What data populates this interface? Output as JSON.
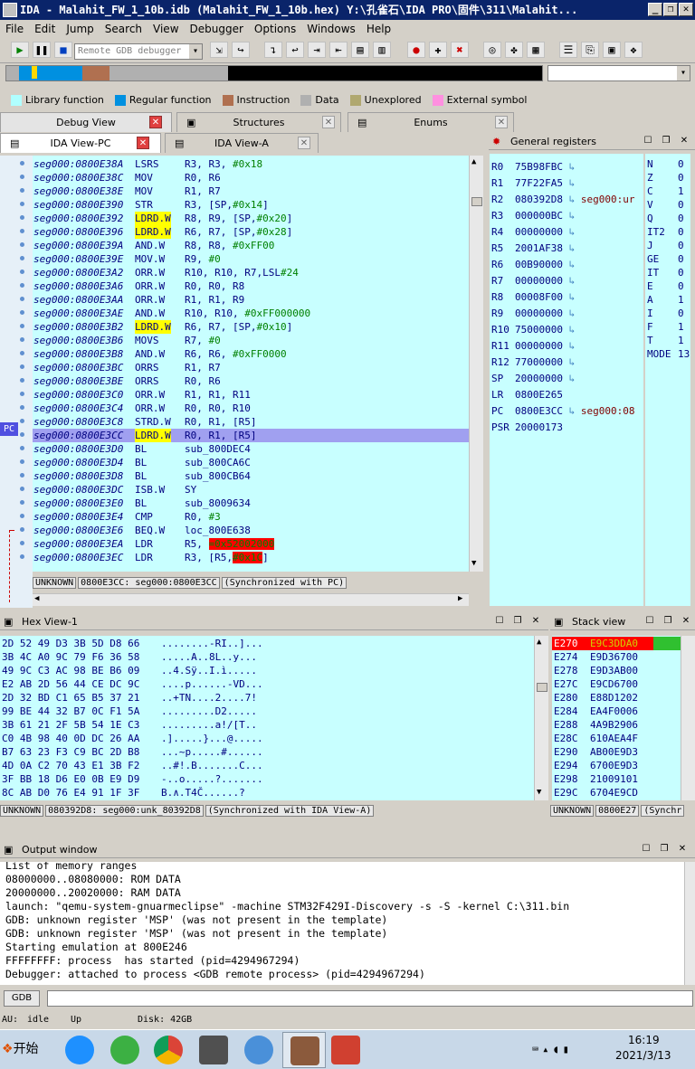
{
  "window": {
    "title": "IDA - Malahit_FW_1_10b.idb (Malahit_FW_1_10b.hex) Y:\\孔雀石\\IDA PRO\\固件\\311\\Malahit..."
  },
  "menu": [
    "File",
    "Edit",
    "Jump",
    "Search",
    "View",
    "Debugger",
    "Options",
    "Windows",
    "Help"
  ],
  "toolbar": {
    "debugger_select": "Remote GDB debugger"
  },
  "legend": [
    {
      "label": "Library function",
      "color": "#b0ffff"
    },
    {
      "label": "Regular function",
      "color": "#0090e0"
    },
    {
      "label": "Instruction",
      "color": "#b07050"
    },
    {
      "label": "Data",
      "color": "#b0b0b0"
    },
    {
      "label": "Unexplored",
      "color": "#b0a870"
    },
    {
      "label": "External symbol",
      "color": "#ff90e0"
    }
  ],
  "top_tabs": [
    "Debug View",
    "Structures",
    "Enums"
  ],
  "view_tabs": [
    "IDA View-PC",
    "IDA View-A"
  ],
  "code": [
    {
      "addr": "seg000:0800E38A",
      "mn": "LSRS",
      "op": "R3, R3, #0x18"
    },
    {
      "addr": "seg000:0800E38C",
      "mn": "MOV",
      "op": "R0, R6"
    },
    {
      "addr": "seg000:0800E38E",
      "mn": "MOV",
      "op": "R1, R7"
    },
    {
      "addr": "seg000:0800E390",
      "mn": "STR",
      "op": "R3, [SP,#0x14]"
    },
    {
      "addr": "seg000:0800E392",
      "mn": "LDRD.W",
      "op": "R8, R9, [SP,#0x20]",
      "hl": true
    },
    {
      "addr": "seg000:0800E396",
      "mn": "LDRD.W",
      "op": "R6, R7, [SP,#0x28]",
      "hl": true
    },
    {
      "addr": "seg000:0800E39A",
      "mn": "AND.W",
      "op": "R8, R8, #0xFF00"
    },
    {
      "addr": "seg000:0800E39E",
      "mn": "MOV.W",
      "op": "R9, #0"
    },
    {
      "addr": "seg000:0800E3A2",
      "mn": "ORR.W",
      "op": "R10, R10, R7,LSL#24"
    },
    {
      "addr": "seg000:0800E3A6",
      "mn": "ORR.W",
      "op": "R0, R0, R8"
    },
    {
      "addr": "seg000:0800E3AA",
      "mn": "ORR.W",
      "op": "R1, R1, R9"
    },
    {
      "addr": "seg000:0800E3AE",
      "mn": "AND.W",
      "op": "R10, R10, #0xFF000000"
    },
    {
      "addr": "seg000:0800E3B2",
      "mn": "LDRD.W",
      "op": "R6, R7, [SP,#0x10]",
      "hl": true
    },
    {
      "addr": "seg000:0800E3B6",
      "mn": "MOVS",
      "op": "R7, #0"
    },
    {
      "addr": "seg000:0800E3B8",
      "mn": "AND.W",
      "op": "R6, R6, #0xFF0000"
    },
    {
      "addr": "seg000:0800E3BC",
      "mn": "ORRS",
      "op": "R1, R7"
    },
    {
      "addr": "seg000:0800E3BE",
      "mn": "ORRS",
      "op": "R0, R6"
    },
    {
      "addr": "seg000:0800E3C0",
      "mn": "ORR.W",
      "op": "R1, R1, R11"
    },
    {
      "addr": "seg000:0800E3C4",
      "mn": "ORR.W",
      "op": "R0, R0, R10"
    },
    {
      "addr": "seg000:0800E3C8",
      "mn": "STRD.W",
      "op": "R0, R1, [R5]"
    },
    {
      "addr": "seg000:0800E3CC",
      "mn": "LDRD.W",
      "op": "R0, R1, [R5]",
      "hl": true,
      "pc": true
    },
    {
      "addr": "seg000:0800E3D0",
      "mn": "BL",
      "op": "sub_800DEC4"
    },
    {
      "addr": "seg000:0800E3D4",
      "mn": "BL",
      "op": "sub_800CA6C"
    },
    {
      "addr": "seg000:0800E3D8",
      "mn": "BL",
      "op": "sub_800CB64"
    },
    {
      "addr": "seg000:0800E3DC",
      "mn": "ISB.W",
      "op": "SY"
    },
    {
      "addr": "seg000:0800E3E0",
      "mn": "BL",
      "op": "sub_8009634"
    },
    {
      "addr": "seg000:0800E3E4",
      "mn": "CMP",
      "op": "R0, #3"
    },
    {
      "addr": "seg000:0800E3E6",
      "mn": "BEQ.W",
      "op": "loc_800E638"
    },
    {
      "addr": "seg000:0800E3EA",
      "mn": "LDR",
      "op": "R5, =0x52002000",
      "red": true
    },
    {
      "addr": "seg000:0800E3EC",
      "mn": "LDR",
      "op": "R3, [R5,#0x1C]",
      "red": true
    }
  ],
  "pc_label": "PC",
  "code_status": [
    "UNKNOWN",
    "0800E3CC: seg000:0800E3CC",
    "(Synchronized with PC)"
  ],
  "registers_title": "General registers",
  "registers": [
    {
      "name": "R0",
      "val": "75B98FBC",
      "arrow": true,
      "ref": ""
    },
    {
      "name": "R1",
      "val": "77F22FA5",
      "arrow": true,
      "ref": ""
    },
    {
      "name": "R2",
      "val": "080392D8",
      "arrow": true,
      "ref": "seg000:ur"
    },
    {
      "name": "R3",
      "val": "000000BC",
      "arrow": true,
      "ref": ""
    },
    {
      "name": "R4",
      "val": "00000000",
      "arrow": true,
      "ref": ""
    },
    {
      "name": "R5",
      "val": "2001AF38",
      "arrow": true,
      "ref": ""
    },
    {
      "name": "R6",
      "val": "00B90000",
      "arrow": true,
      "ref": ""
    },
    {
      "name": "R7",
      "val": "00000000",
      "arrow": true,
      "ref": ""
    },
    {
      "name": "R8",
      "val": "00008F00",
      "arrow": true,
      "ref": ""
    },
    {
      "name": "R9",
      "val": "00000000",
      "arrow": true,
      "ref": ""
    },
    {
      "name": "R10",
      "val": "75000000",
      "arrow": true,
      "ref": ""
    },
    {
      "name": "R11",
      "val": "00000000",
      "arrow": true,
      "ref": ""
    },
    {
      "name": "R12",
      "val": "77000000",
      "arrow": true,
      "ref": ""
    },
    {
      "name": "SP",
      "val": "20000000",
      "arrow": true,
      "ref": ""
    },
    {
      "name": "LR",
      "val": "0800E265",
      "arrow": false,
      "ref": ""
    },
    {
      "name": "PC",
      "val": "0800E3CC",
      "arrow": true,
      "ref": "seg000:08"
    },
    {
      "name": "PSR",
      "val": "20000173",
      "arrow": false,
      "ref": ""
    }
  ],
  "flags": [
    {
      "n": "N",
      "v": "0"
    },
    {
      "n": "Z",
      "v": "0"
    },
    {
      "n": "C",
      "v": "1"
    },
    {
      "n": "V",
      "v": "0"
    },
    {
      "n": "Q",
      "v": "0"
    },
    {
      "n": "IT2",
      "v": "0"
    },
    {
      "n": "J",
      "v": "0"
    },
    {
      "n": "GE",
      "v": "0"
    },
    {
      "n": "IT",
      "v": "0"
    },
    {
      "n": "E",
      "v": "0"
    },
    {
      "n": "A",
      "v": "1"
    },
    {
      "n": "I",
      "v": "0"
    },
    {
      "n": "F",
      "v": "1"
    },
    {
      "n": "T",
      "v": "1"
    },
    {
      "n": "MODE",
      "v": "13"
    }
  ],
  "hex_title": "Hex View-1",
  "hex": [
    {
      "b": "2D 52 49 D3 3B 5D D8 66",
      "a": "........-RI..]..."
    },
    {
      "b": "3B 4C A0 9C 79 F6 36 58",
      "a": ".....A..8L..y..."
    },
    {
      "b": "49 9C C3 AC 98 BE B6 09",
      "a": "..4.Sÿ..I.ì....."
    },
    {
      "b": "E2 AB 2D 56 44 CE DC 9C",
      "a": "....p......-VD..."
    },
    {
      "b": "2D 32 BD C1 65 B5 37 21",
      "a": "..+TN....2....7!"
    },
    {
      "b": "99 BE 44 32 B7 0C F1 5A",
      "a": ".........D2....."
    },
    {
      "b": "3B 61 21 2F 5B 54 1E C3",
      "a": ".........a!/[T.."
    },
    {
      "b": "C0 4B 98 40 0D DC 26 AA",
      "a": ".].....}...@....."
    },
    {
      "b": "B7 63 23 F3 C9 BC 2D B8",
      "a": "...~p.....#......"
    },
    {
      "b": "4D 0A C2 70 43 E1 3B F2",
      "a": "..#!.B.......C..."
    },
    {
      "b": "3F BB 18 D6 E0 0B E9 D9",
      "a": "-..o.....?......."
    },
    {
      "b": "8C AB D0 76 E4 91 1F 3F",
      "a": "B.∧.T4Č......?"
    }
  ],
  "hex_status": [
    "UNKNOWN",
    "080392D8: seg000:unk_80392D8",
    "(Synchronized with IDA View-A)"
  ],
  "stack_title": "Stack view",
  "stack": [
    {
      "a": "E270",
      "v": "E9C3DDA0",
      "sel": true
    },
    {
      "a": "E274",
      "v": "E9D36700"
    },
    {
      "a": "E278",
      "v": "E9D3AB00"
    },
    {
      "a": "E27C",
      "v": "E9CD6700"
    },
    {
      "a": "E280",
      "v": "E88D1202"
    },
    {
      "a": "E284",
      "v": "EA4F0006"
    },
    {
      "a": "E288",
      "v": "4A9B2906"
    },
    {
      "a": "E28C",
      "v": "610AEA4F"
    },
    {
      "a": "E290",
      "v": "AB00E9D3"
    },
    {
      "a": "E294",
      "v": "6700E9D3"
    },
    {
      "a": "E298",
      "v": "21009101"
    },
    {
      "a": "E29C",
      "v": "6704E9CD"
    }
  ],
  "stack_status": [
    "UNKNOWN",
    "0800E27",
    "(Synchr"
  ],
  "output_title": "Output window",
  "output": [
    "List of memory ranges",
    "08000000..08080000: ROM DATA",
    "20000000..20020000: RAM DATA",
    "launch: \"qemu-system-gnuarmeclipse\" -machine STM32F429I-Discovery -s -S -kernel C:\\311.bin",
    "GDB: unknown register 'MSP' (was not present in the template)",
    "GDB: unknown register 'MSP' (was not present in the template)",
    "Starting emulation at 800E246",
    "FFFFFFFF: process  has started (pid=4294967294)",
    "Debugger: attached to process <GDB remote process> (pid=4294967294)"
  ],
  "gdb_button": "GDB",
  "statusbar": {
    "au": "AU:",
    "state": "idle",
    "dir": "Up",
    "disk": "Disk: 42GB"
  },
  "taskbar": {
    "start": "开始",
    "time": "16:19",
    "date": "2021/3/13"
  }
}
